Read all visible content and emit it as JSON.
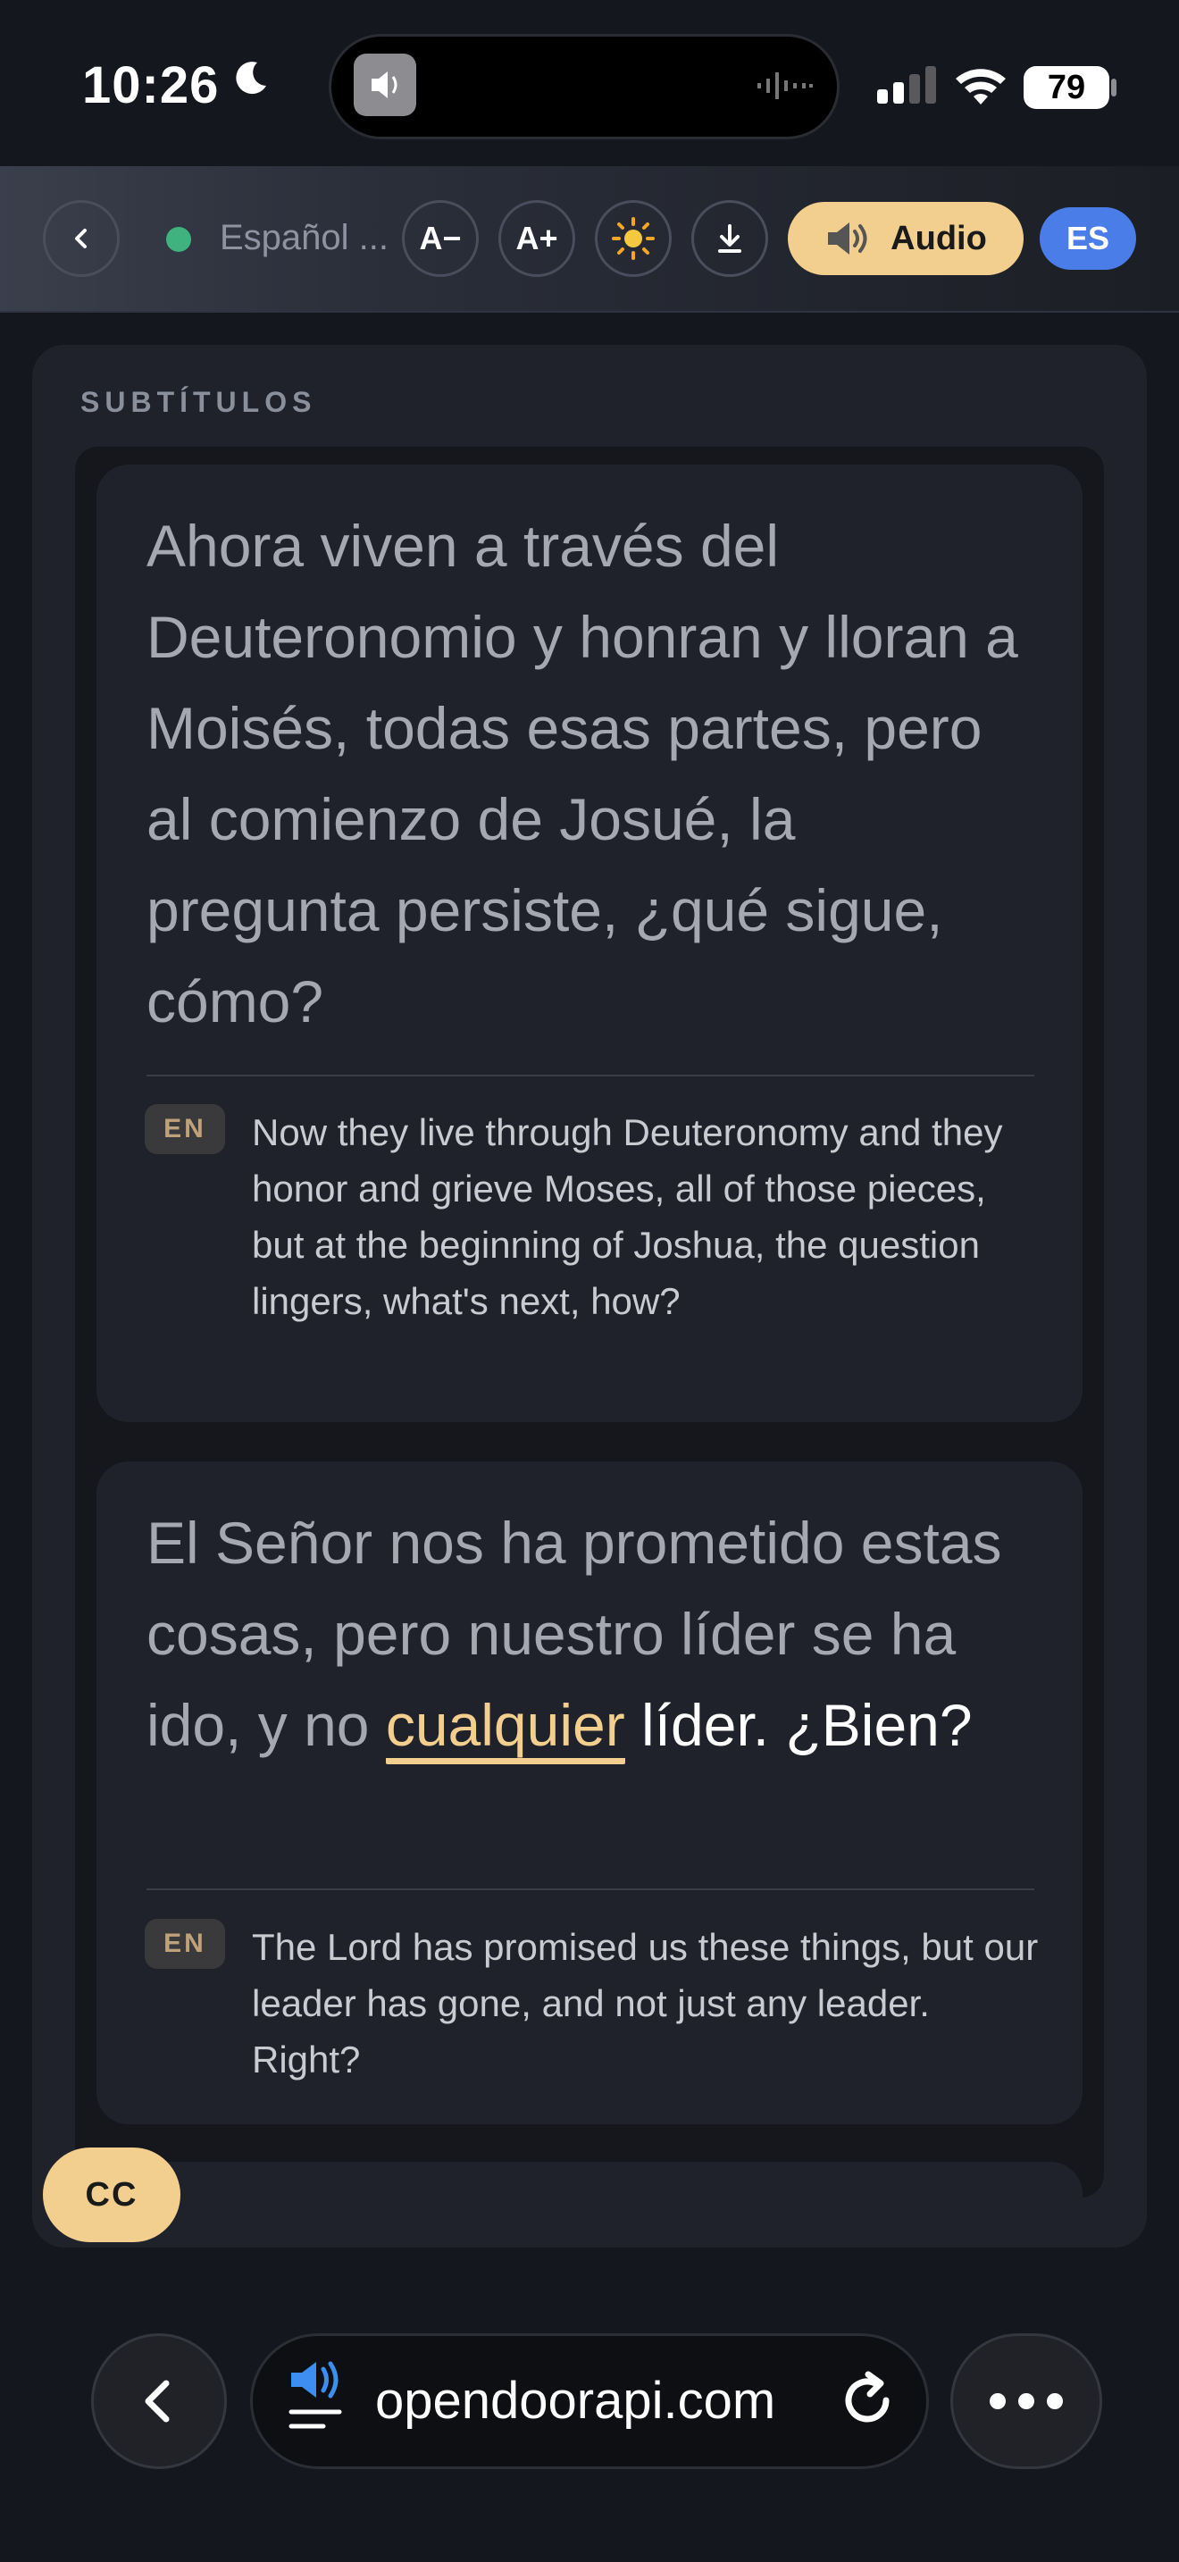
{
  "status_bar": {
    "time": "10:26",
    "battery": "79"
  },
  "toolbar": {
    "back_icon": "chevron-left-icon",
    "language_label": "Español ...",
    "font_decrease": "A−",
    "font_increase": "A+",
    "theme_icon": "sun-icon",
    "download_icon": "download-icon",
    "audio_label": "Audio",
    "language_code": "ES"
  },
  "panel": {
    "title": "SUBTÍTULOS"
  },
  "subtitles": [
    {
      "es": "Ahora viven a través del Deuteronomio y honran y lloran a Moisés, todas esas partes, pero al comienzo de Josué, la pregunta persiste, ¿qué sigue, cómo?",
      "tag": "EN",
      "en": "Now they live through Deuteronomy and they honor and grieve Moses, all of those pieces, but at the beginning of Joshua, the question lingers, what's next, how?"
    },
    {
      "es_before": "El Señor nos ha prometido estas cosas, pero nuestro líder se ha ido, y no",
      "es_highlight": "cualquier",
      "es_after": "líder. ¿Bien?",
      "tag": "EN",
      "en": "The Lord has promised us these things, but our leader has gone, and not just any leader. Right?"
    }
  ],
  "cc_label": "CC",
  "browser": {
    "url": "opendoorapi.com"
  },
  "colors": {
    "accent": "#f2cf8e",
    "badge_blue": "#4a7de8",
    "status_green": "#3fb37f",
    "background": "#15171e",
    "card": "#1f222b"
  }
}
